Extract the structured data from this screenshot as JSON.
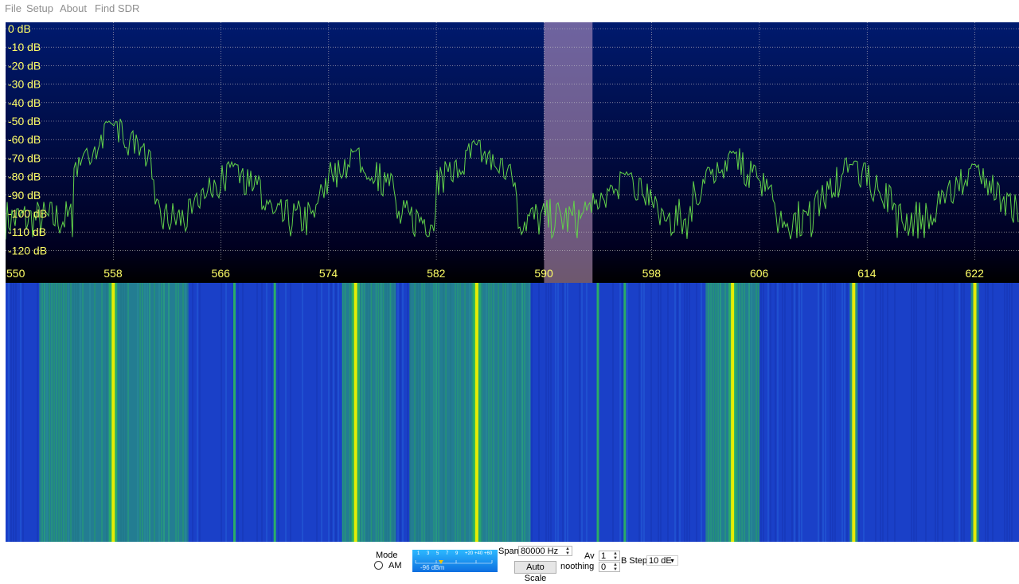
{
  "menu": {
    "file": "File",
    "setup": "Setup",
    "about": "About",
    "find_sdr": "Find SDR"
  },
  "spectrum": {
    "db_labels": [
      "0 dB",
      "-10 dB",
      "-20 dB",
      "-30 dB",
      "-40 dB",
      "-50 dB",
      "-60 dB",
      "-70 dB",
      "-80 dB",
      "-90 dB",
      "-100 dB",
      "-110 dB",
      "-120 dB"
    ],
    "freq_labels": [
      "550",
      "558",
      "566",
      "574",
      "582",
      "590",
      "598",
      "606",
      "614",
      "622"
    ],
    "freq_range_khz": [
      550,
      626
    ],
    "db_range": [
      -128,
      0
    ],
    "tuned_band_khz": [
      590,
      593.6
    ],
    "peaks": [
      {
        "freq": 558,
        "level": -53
      },
      {
        "freq": 567,
        "level": -75
      },
      {
        "freq": 576,
        "level": -67
      },
      {
        "freq": 585,
        "level": -63
      },
      {
        "freq": 596,
        "level": -80
      },
      {
        "freq": 604,
        "level": -69
      },
      {
        "freq": 613,
        "level": -74
      },
      {
        "freq": 622,
        "level": -76
      }
    ],
    "colors": {
      "background_top": "#001a6e",
      "background_bottom": "#000000",
      "trace": "#62d24a",
      "label": "#ffff66",
      "grid": "#c8c8c8",
      "tuned_band": "#c8a0c8"
    }
  },
  "waterfall": {
    "colors": {
      "base": "#1a40c8",
      "warm": "#2fc850",
      "hot": "#f0f000"
    },
    "strong_carriers_khz": [
      558,
      576,
      585,
      604,
      613,
      622
    ],
    "weak_carriers_khz": [
      567,
      570,
      594,
      596
    ],
    "noise_bands_khz": [
      [
        552.5,
        563.5
      ],
      [
        575,
        579
      ],
      [
        580,
        589
      ],
      [
        602,
        606
      ]
    ]
  },
  "controls": {
    "mode_label": "Mode",
    "mode_am": "AM",
    "smeter_value": "-96 dBm",
    "smeter_ticks": [
      "1",
      "3",
      "5",
      "7",
      "9",
      "+20",
      "+40",
      "+60"
    ],
    "span_label": "Span",
    "span_value": "80000 Hz",
    "auto_scale_label": "Auto Scale",
    "smoothing_label": "noothing",
    "smoothing_value": "0",
    "av_label": "Av",
    "av_value": "1",
    "db_step_label": "B Step",
    "db_step_value": "10 dE"
  }
}
